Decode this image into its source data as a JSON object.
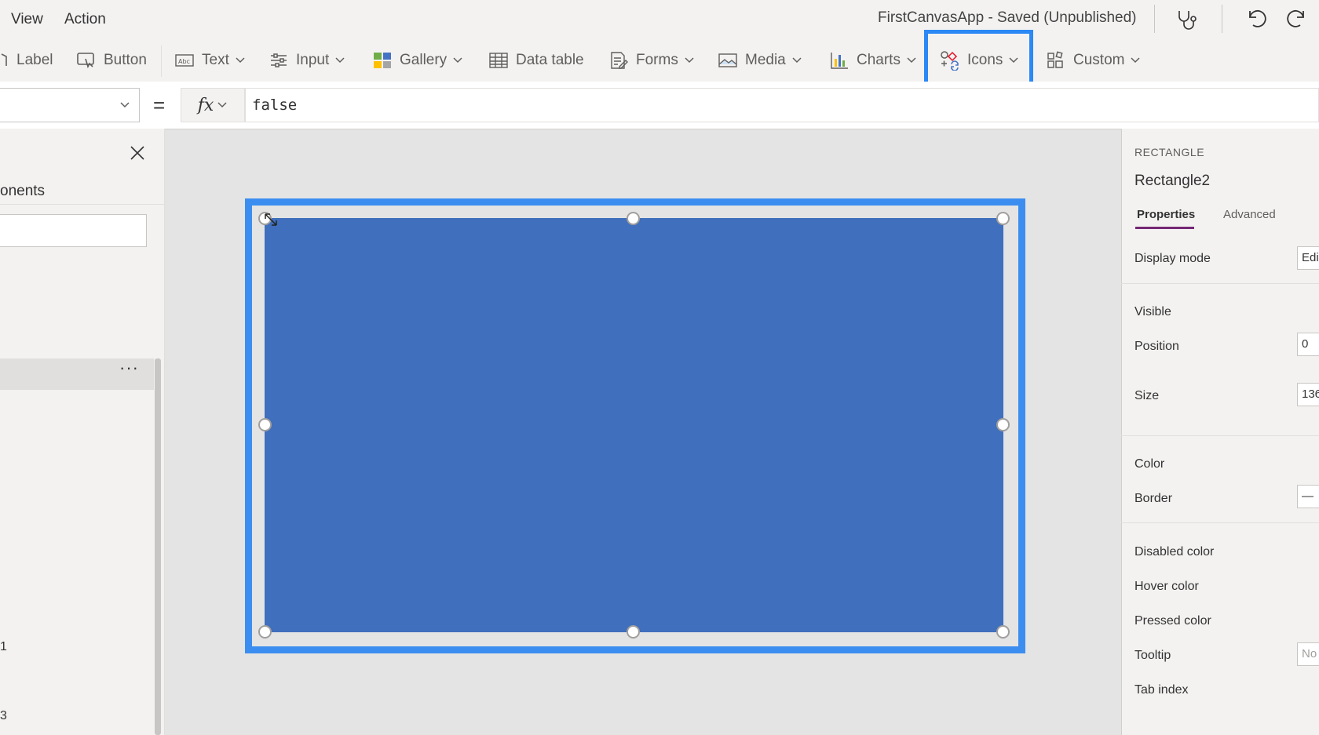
{
  "menu": {
    "items": [
      "View",
      "Action"
    ]
  },
  "app_title": "FirstCanvasApp - Saved (Unpublished)",
  "ribbon": {
    "label": "Label",
    "button": "Button",
    "text": "Text",
    "input": "Input",
    "gallery": "Gallery",
    "data_table": "Data table",
    "forms": "Forms",
    "media": "Media",
    "charts": "Charts",
    "icons": "Icons",
    "custom": "Custom"
  },
  "formula": {
    "fx": "fx",
    "equals": "=",
    "value": "false"
  },
  "left_panel": {
    "tab_text": "onents",
    "more": "···",
    "row_numbers": [
      "1",
      "3"
    ]
  },
  "canvas": {
    "selected_control": "Rectangle2",
    "fill_color": "#3f6fbd",
    "selection_color": "#3b8ef0"
  },
  "properties_panel": {
    "type": "RECTANGLE",
    "name": "Rectangle2",
    "tabs": [
      "Properties",
      "Advanced"
    ],
    "rows": {
      "display_mode": {
        "label": "Display mode",
        "value": "Edi"
      },
      "visible": {
        "label": "Visible"
      },
      "position": {
        "label": "Position",
        "value": "0"
      },
      "size": {
        "label": "Size",
        "value": "136"
      },
      "color": {
        "label": "Color"
      },
      "border": {
        "label": "Border",
        "value": "—"
      },
      "disabled_color": {
        "label": "Disabled color"
      },
      "hover_color": {
        "label": "Hover color"
      },
      "pressed_color": {
        "label": "Pressed color"
      },
      "tooltip": {
        "label": "Tooltip",
        "value": "No"
      },
      "tab_index": {
        "label": "Tab index"
      }
    }
  },
  "colors": {
    "accent_purple": "#742774",
    "highlight_blue": "#2b88f5"
  }
}
